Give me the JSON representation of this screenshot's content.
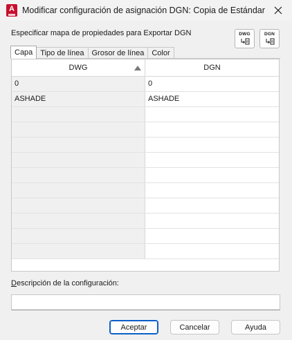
{
  "window": {
    "title": "Modificar configuración de asignación DGN: Copia de Estándar",
    "app_icon_letter": "A"
  },
  "heading": "Especificar mapa de propiedades para Exportar DGN",
  "map_buttons": [
    {
      "label": "DWG",
      "icon": "dwg-to-dgn-mapping-icon"
    },
    {
      "label": "DGN",
      "icon": "dgn-to-dwg-mapping-icon"
    }
  ],
  "tabs": [
    {
      "label": "Capa",
      "active": true
    },
    {
      "label": "Tipo de línea",
      "active": false
    },
    {
      "label": "Grosor de línea",
      "active": false
    },
    {
      "label": "Color",
      "active": false
    }
  ],
  "grid": {
    "columns": [
      "DWG",
      "DGN"
    ],
    "sort_column": "DWG",
    "sort_direction": "ascending",
    "rows": [
      [
        "0",
        "0"
      ],
      [
        "ASHADE",
        "ASHADE"
      ],
      [
        "",
        ""
      ],
      [
        "",
        ""
      ],
      [
        "",
        ""
      ],
      [
        "",
        ""
      ],
      [
        "",
        ""
      ],
      [
        "",
        ""
      ],
      [
        "",
        ""
      ],
      [
        "",
        ""
      ],
      [
        "",
        ""
      ],
      [
        "",
        ""
      ]
    ]
  },
  "description": {
    "label_underlined": "D",
    "label_rest": "escripción de la configuración:",
    "value": ""
  },
  "buttons": {
    "accept": "Aceptar",
    "cancel": "Cancelar",
    "help": "Ayuda"
  },
  "colors": {
    "accent": "#0a5ec7",
    "app_icon": "#c8102e"
  }
}
